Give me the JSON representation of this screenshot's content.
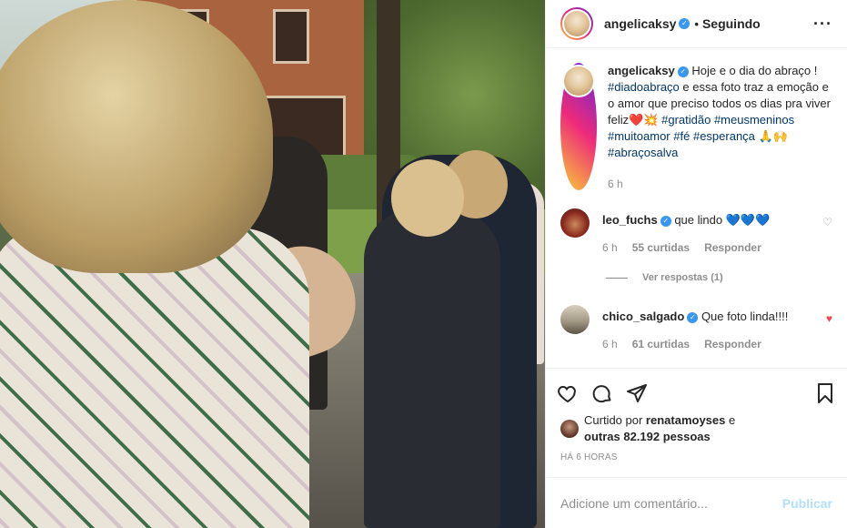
{
  "header": {
    "username": "angelicaksy",
    "separator": "•",
    "follow_label": "Seguindo",
    "more_label": "···"
  },
  "caption": {
    "username": "angelicaksy",
    "parts": [
      {
        "t": "Hoje e o dia do abraço ! "
      },
      {
        "t": "#diadoabraço",
        "tag": true
      },
      {
        "t": " e essa foto traz a emoção e o amor que preciso todos os dias pra viver feliz❤️💥 "
      },
      {
        "t": "#gratidão",
        "tag": true
      },
      {
        "t": " "
      },
      {
        "t": "#meusmeninos",
        "tag": true
      },
      {
        "t": " "
      },
      {
        "t": "#muitoamor",
        "tag": true
      },
      {
        "t": " "
      },
      {
        "t": "#fé",
        "tag": true
      },
      {
        "t": " "
      },
      {
        "t": "#esperança",
        "tag": true
      },
      {
        "t": " 🙏🙌 "
      },
      {
        "t": "#abraçosalva",
        "tag": true
      }
    ],
    "time": "6 h"
  },
  "comments": [
    {
      "username": "leo_fuchs",
      "text": "que lindo 💙💙💙",
      "time": "6 h",
      "likes": "55 curtidas",
      "reply_label": "Responder",
      "view_replies": "Ver respostas (1)",
      "liked": false,
      "heart_icon": "heart-outline-icon"
    },
    {
      "username": "chico_salgado",
      "text": "Que foto linda!!!!",
      "time": "6 h",
      "likes": "61 curtidas",
      "reply_label": "Responder",
      "liked": true,
      "heart_icon": "heart-filled-icon"
    }
  ],
  "likes": {
    "prefix": "Curtido por ",
    "user": "renatamoyses",
    "middle": " e ",
    "others": "outras 82.192 pessoas"
  },
  "timestamp": "HÁ 6 HORAS",
  "add_comment": {
    "placeholder": "Adicione um comentário...",
    "publish_label": "Publicar"
  },
  "colors": {
    "hashtag": "#00376b",
    "verified": "#3897f0",
    "liked_heart": "#ed4956",
    "publish_disabled": "#b2dffc"
  }
}
